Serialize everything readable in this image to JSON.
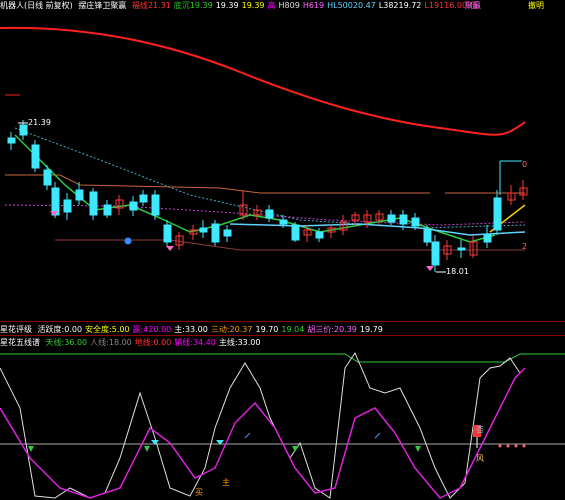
{
  "header": {
    "title": "机器人(日线 前复权)",
    "indicator_name": "摆庄锋卫聚赢",
    "items": [
      {
        "label": "福线",
        "value": "21.31",
        "color": "#ff3333"
      },
      {
        "label": "底沉",
        "value": "19.39",
        "color": "#33cc33"
      },
      {
        "label": "",
        "value": "19.39",
        "color": "#ffffff"
      },
      {
        "label": "",
        "value": "19.39",
        "color": "#ffff00"
      },
      {
        "label": "",
        "value": "高",
        "color": "#ff00ff"
      },
      {
        "label": "H809",
        "value": "",
        "color": "#dddddd"
      },
      {
        "label": "H619",
        "value": "",
        "color": "#ff66ff"
      },
      {
        "label": "HL500",
        "value": "20.47",
        "color": "#5fd3ff"
      },
      {
        "label": "L382",
        "value": "19.72",
        "color": "#ffffff"
      },
      {
        "label": "L191",
        "value": "16.00",
        "color": "#ff3333"
      },
      {
        "label": "",
        "value": "低",
        "color": "#ff3333"
      }
    ],
    "right_label_1": "聚赢",
    "right_label_2": "撤明"
  },
  "main_chart": {
    "high_label": "21.39",
    "low_label": "18.01",
    "right_mark_top": "0",
    "right_mark_bottom": "2",
    "colors": {
      "up": "#ff3b3b",
      "down": "#3ee8ff",
      "ma_fast": "#2ecc40",
      "ma_slow": "#5fd3ff",
      "trend": "#ff2020",
      "band": "#c8643c",
      "dotted_cyan": "#3fb0c8",
      "dotted_magenta": "#cc44cc"
    }
  },
  "sub_header_1": {
    "name": "星花评级",
    "items": [
      {
        "label": "活跃度:",
        "value": "0.00",
        "color": "#ffffff"
      },
      {
        "label": "安全度:",
        "value": "5.00",
        "color": "#ffff00"
      },
      {
        "label": "赢:",
        "value": "420.00",
        "color": "#ff00ff"
      },
      {
        "label": "主:",
        "value": "33.00",
        "color": "#ffffff"
      },
      {
        "label": "三动:",
        "value": "20.37",
        "color": "#ff9900"
      },
      {
        "label": "",
        "value": "19.70",
        "color": "#ffffff"
      },
      {
        "label": "",
        "value": "19.04",
        "color": "#33cc33"
      },
      {
        "label": "胡三价:",
        "value": "20.39",
        "color": "#ff66ff"
      },
      {
        "label": "",
        "value": "19.79",
        "color": "#ffffff"
      }
    ]
  },
  "sub_header_2": {
    "name": "星花五线谱",
    "items": [
      {
        "label": "天线:",
        "value": "36.00",
        "color": "#33cc33"
      },
      {
        "label": "人线:",
        "value": "18.00",
        "color": "#888888"
      },
      {
        "label": "地线:",
        "value": "0.00",
        "color": "#ff3333"
      },
      {
        "label": "辅线:",
        "value": "34.40",
        "color": "#ff00ff"
      },
      {
        "label": "主线:",
        "value": "33.00",
        "color": "#ffffff"
      }
    ]
  },
  "sub_chart": {
    "tags": {
      "buy": "买",
      "main": "主",
      "wind": "风",
      "sun": "杏"
    }
  }
}
